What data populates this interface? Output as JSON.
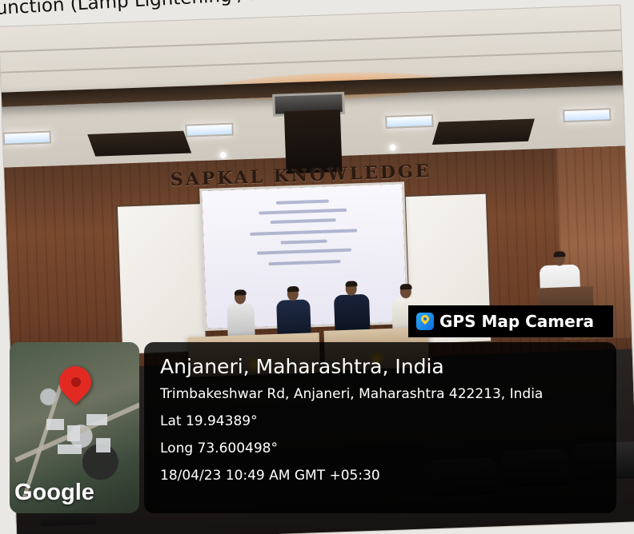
{
  "caption": "unction (Lamp Lightening / Felicitation of RP / Vo",
  "scene": {
    "wall_sign": "SAPKAL KNOWLEDGE HUB"
  },
  "overlay": {
    "app_name": "GPS Map Camera",
    "app_icon": "gps-map-camera-logo-icon",
    "map_watermark": "Google",
    "location_title": "Anjaneri, Maharashtra, India",
    "address": "Trimbakeshwar Rd, Anjaneri, Maharashtra 422213, India",
    "latitude": "Lat 19.94389°",
    "longitude": "Long 73.600498°",
    "timestamp": "18/04/23 10:49 AM GMT +05:30",
    "pin_color": "#e22a23",
    "panel_color": "#000000"
  }
}
